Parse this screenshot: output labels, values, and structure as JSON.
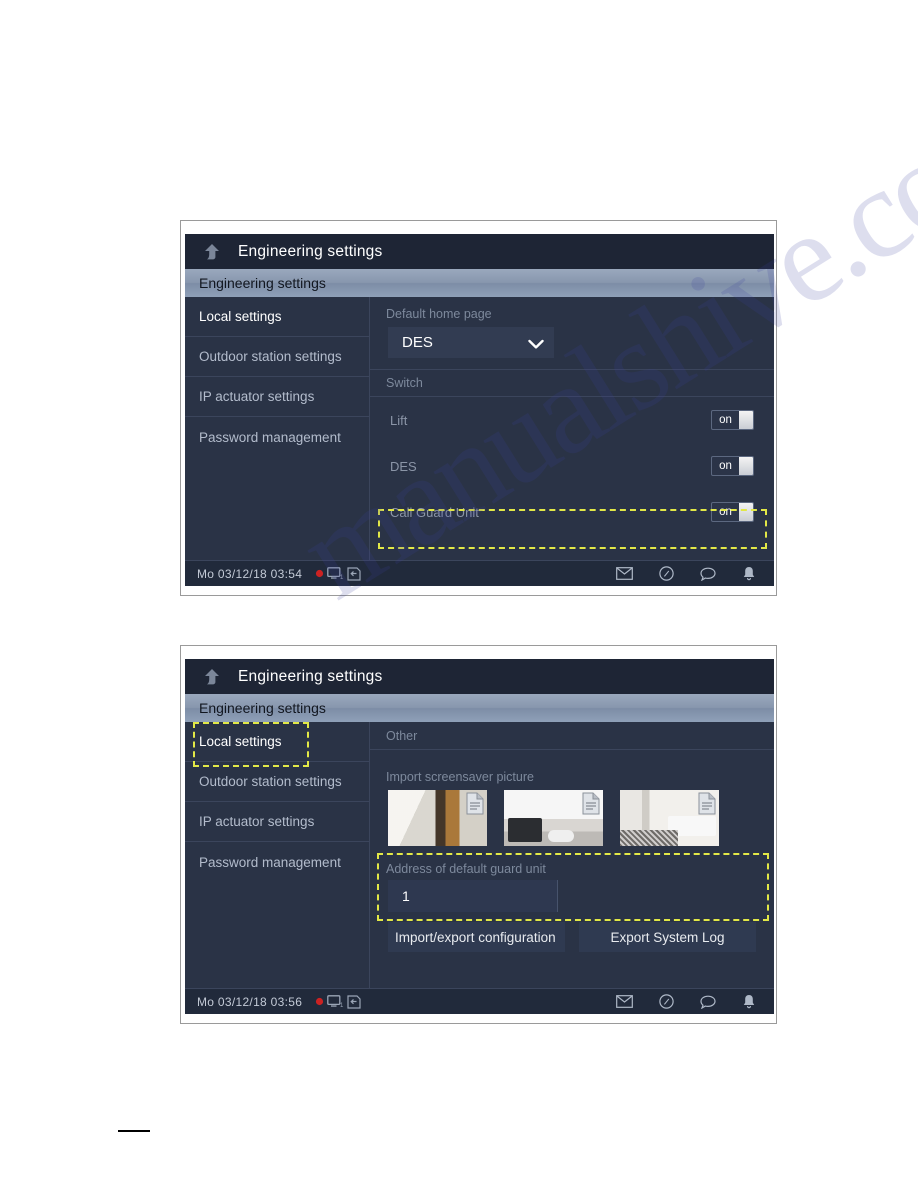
{
  "panels": [
    {
      "titlebar": {
        "back_icon": "back-arrow-icon",
        "title": "Engineering settings"
      },
      "breadcrumb": "Engineering settings",
      "sidebar": [
        {
          "label": "Local settings",
          "active": true
        },
        {
          "label": "Outdoor station settings",
          "active": false
        },
        {
          "label": "IP actuator settings",
          "active": false
        },
        {
          "label": "Password management",
          "active": false
        }
      ],
      "content": {
        "default_home_page_label": "Default home page",
        "default_home_page_value": "DES",
        "section_switch_label": "Switch",
        "switches": [
          {
            "label": "Lift",
            "state": "on"
          },
          {
            "label": "DES",
            "state": "on"
          },
          {
            "label": "Call Guard Unit",
            "state": "on"
          }
        ]
      },
      "statusbar": {
        "datetime": "Mo 03/12/18  03:54",
        "left_icons": [
          "record-dot-icon",
          "monitor-icon",
          "door-release-icon"
        ],
        "right_icons": [
          "mail-icon",
          "history-clock-icon",
          "message-icon",
          "bell-icon"
        ]
      },
      "highlight": "Call Guard Unit"
    },
    {
      "titlebar": {
        "back_icon": "back-arrow-icon",
        "title": "Engineering settings"
      },
      "breadcrumb": "Engineering settings",
      "sidebar": [
        {
          "label": "Local settings",
          "active": true
        },
        {
          "label": "Outdoor station settings",
          "active": false
        },
        {
          "label": "IP actuator settings",
          "active": false
        },
        {
          "label": "Password management",
          "active": false
        }
      ],
      "content": {
        "section_other_label": "Other",
        "import_screensaver_label": "Import screensaver picture",
        "thumbnails": [
          "screensaver-thumbnail-1",
          "screensaver-thumbnail-2",
          "screensaver-thumbnail-3"
        ],
        "guard_unit_label": "Address of default guard unit",
        "guard_unit_value": "1",
        "buttons": [
          {
            "label": "Import/export configuration"
          },
          {
            "label": "Export System Log"
          }
        ]
      },
      "statusbar": {
        "datetime": "Mo 03/12/18  03:56",
        "left_icons": [
          "record-dot-icon",
          "monitor-icon",
          "door-release-icon"
        ],
        "right_icons": [
          "mail-icon",
          "history-clock-icon",
          "message-icon",
          "bell-icon"
        ]
      },
      "highlights": [
        "Local settings",
        "Address of default guard unit"
      ]
    }
  ],
  "watermark": {
    "text": "manualshive.com"
  },
  "colors": {
    "screen_bg": "#2a3346",
    "titlebar_bg": "#1e2535",
    "highlight": "#e2e847",
    "accent_text": "#ffffff",
    "muted_text": "#7d899c"
  }
}
